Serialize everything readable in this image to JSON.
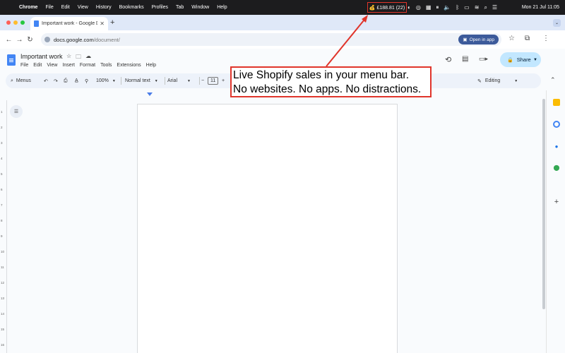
{
  "menubar": {
    "app_name": "Chrome",
    "items": [
      "File",
      "Edit",
      "View",
      "History",
      "Bookmarks",
      "Profiles",
      "Tab",
      "Window",
      "Help"
    ],
    "sales_widget": "💰 £188.81 (22)",
    "clock": "Mon 21 Jul  11:05"
  },
  "browser": {
    "tab_title": "Important work - Google Docs",
    "url_host": "docs.google.com",
    "url_path": "/document/",
    "open_in_app": "Open in app"
  },
  "docs": {
    "title": "Important work",
    "menu": [
      "File",
      "Edit",
      "View",
      "Insert",
      "Format",
      "Tools",
      "Extensions",
      "Help"
    ],
    "share_label": "Share",
    "toolbar": {
      "menus_label": "Menus",
      "zoom": "100%",
      "style": "Normal text",
      "font": "Arial",
      "font_size": "11",
      "mode": "Editing"
    }
  },
  "callout": {
    "line1": "Live Shopify sales in your menu bar.",
    "line2": "No websites. No apps. No distractions."
  },
  "ruler_numbers": [
    "1",
    "2",
    "3",
    "4",
    "5",
    "6",
    "7",
    "8",
    "9",
    "10",
    "11",
    "12",
    "13",
    "14",
    "15",
    "16"
  ],
  "colors": {
    "accent": "#e0352b",
    "share_bg": "#c2e7ff",
    "docs_blue": "#4285f4"
  }
}
